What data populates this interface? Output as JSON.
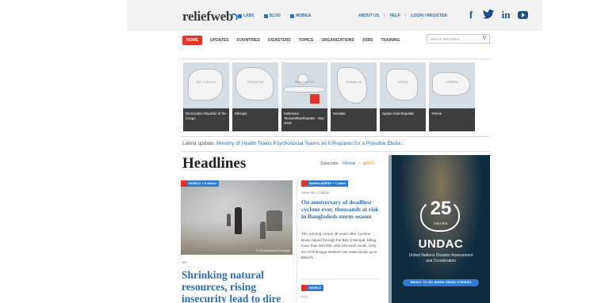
{
  "header": {
    "logo_text": "reliefweb",
    "util_links": [
      "LABS",
      "BLOG",
      "MOBILE"
    ],
    "account_links": [
      "ABOUT US",
      "HELP",
      "LOGIN / REGISTER"
    ],
    "socials": [
      "f",
      "twitter-icon",
      "in",
      "youtube-icon"
    ]
  },
  "nav": {
    "items": [
      "HOME",
      "UPDATES",
      "COUNTRIES",
      "DISASTERS",
      "TOPICS",
      "ORGANIZATIONS",
      "JOBS",
      "TRAINING"
    ],
    "search_placeholder": "Search ReliefWeb"
  },
  "tiles": [
    {
      "map_label": "DR CONGO",
      "caption": "Democratic Republic of the Congo"
    },
    {
      "map_label": "ETHIOPIA",
      "caption": "Ethiopia"
    },
    {
      "map_label": "INDONESIA",
      "caption": "Indonesia: Tsunami/Earthquake - Sep 2018"
    },
    {
      "map_label": "SOMALIA",
      "caption": "Somalia"
    },
    {
      "map_label": "SYRIA",
      "caption": "Syrian Arab Republic"
    },
    {
      "map_label": "YEMEN",
      "caption": "Yemen"
    }
  ],
  "latest": {
    "label": "Latest update:",
    "link": "Ministry of Health Trains Psychosocial Teams as it Prepares for a Possible Ebola..."
  },
  "headlines": {
    "title": "Headlines",
    "subscribe_label": "Subscribe:",
    "email": "Email",
    "rss": "RSS"
  },
  "main_story": {
    "tag": "WORLD + 5 others",
    "photo_credit": "© OCHA/Naomi Frerotte",
    "source": "UN",
    "title": "Shrinking natural resources, rising insecurity lead to dire"
  },
  "side_story": {
    "tag": "BANGLADESH + 1 other",
    "source": "Save the Children",
    "title": "On anniversary of deadliest cyclone ever, thousands at risk in Bangladesh storm season",
    "body": "The warning comes 48 years after Cyclone Bhola ripped through the Bay of Bengal, killing more than 500,000, with 240 km/h winds. Only 5% of Rohingya shelters can resist winds up to 80km/h.",
    "tag2": "WORLD",
    "source2": "FAO"
  },
  "ad": {
    "number": "25",
    "years": "YEARS",
    "name": "UNDAC",
    "subtitle": "United Nations Disaster Assessment and Coordination",
    "cta": "READY TO GO WHEN CRISIS STRIKES"
  },
  "colors": {
    "accent_red": "#e2362a",
    "link_blue": "#2d6fb6",
    "tile_caption_bg": "#3d3d3d",
    "ad_bg": "#0f2b3e"
  }
}
